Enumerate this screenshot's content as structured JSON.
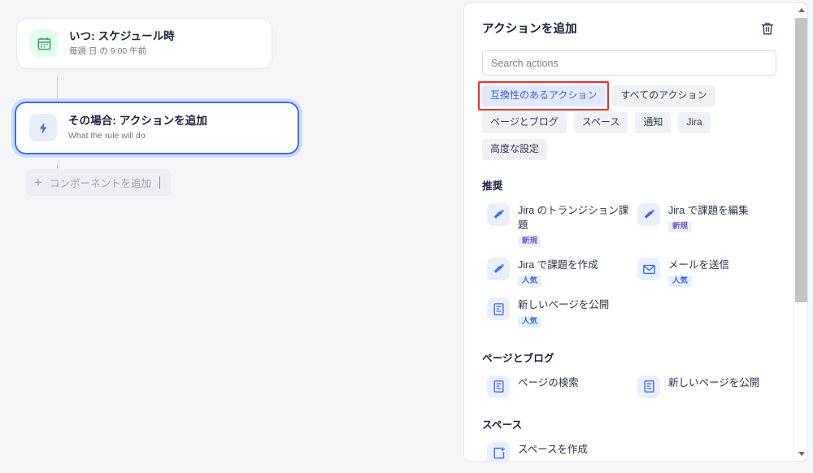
{
  "canvas": {
    "trigger_node": {
      "icon": "calendar-icon",
      "title": "いつ: スケジュール時",
      "subtitle": "毎週 日 の 9:00 午前"
    },
    "action_node": {
      "icon": "lightning-bolt-icon",
      "title": "その場合: アクションを追加",
      "subtitle": "What the rule will do",
      "selected": true
    },
    "add_component_label": "コンポーネントを追加"
  },
  "panel": {
    "title": "アクションを追加",
    "delete_icon": "trash-icon",
    "search": {
      "value": "",
      "placeholder": "Search actions"
    },
    "chips": [
      {
        "label": "互換性のあるアクション",
        "active": true,
        "highlighted": true
      },
      {
        "label": "すべてのアクション",
        "active": false,
        "highlighted": false
      },
      {
        "label": "ページとブログ",
        "active": false,
        "highlighted": false
      },
      {
        "label": "スペース",
        "active": false,
        "highlighted": false
      },
      {
        "label": "通知",
        "active": false,
        "highlighted": false
      },
      {
        "label": "Jira",
        "active": false,
        "highlighted": false
      },
      {
        "label": "高度な設定",
        "active": false,
        "highlighted": false
      }
    ],
    "sections": [
      {
        "title": "推奨",
        "items": [
          {
            "label": "Jira のトランジション課題",
            "icon": "jira-icon",
            "badge": "新規",
            "badge_type": "new"
          },
          {
            "label": "Jira で課題を編集",
            "icon": "jira-icon",
            "badge": "新規",
            "badge_type": "new"
          },
          {
            "label": "Jira で課題を作成",
            "icon": "jira-icon",
            "badge": "人気",
            "badge_type": "hot"
          },
          {
            "label": "メールを送信",
            "icon": "envelope-icon",
            "badge": "人気",
            "badge_type": "hot"
          },
          {
            "label": "新しいページを公開",
            "icon": "page-icon",
            "badge": "人気",
            "badge_type": "hot"
          }
        ]
      },
      {
        "title": "ページとブログ",
        "items": [
          {
            "label": "ページの検索",
            "icon": "page-icon",
            "badge": "",
            "badge_type": ""
          },
          {
            "label": "新しいページを公開",
            "icon": "page-icon",
            "badge": "",
            "badge_type": ""
          }
        ]
      },
      {
        "title": "スペース",
        "items": [
          {
            "label": "スペースを作成",
            "icon": "space-icon",
            "badge": "",
            "badge_type": ""
          }
        ]
      }
    ]
  },
  "colors": {
    "accent_blue": "#3b6ef5",
    "highlight_red": "#f92a1e",
    "badge_new": "#6b5ccc",
    "badge_hot": "#3a6ae0",
    "trigger_green": "#4caf7d",
    "canvas_bg": "#f4f5f9"
  }
}
